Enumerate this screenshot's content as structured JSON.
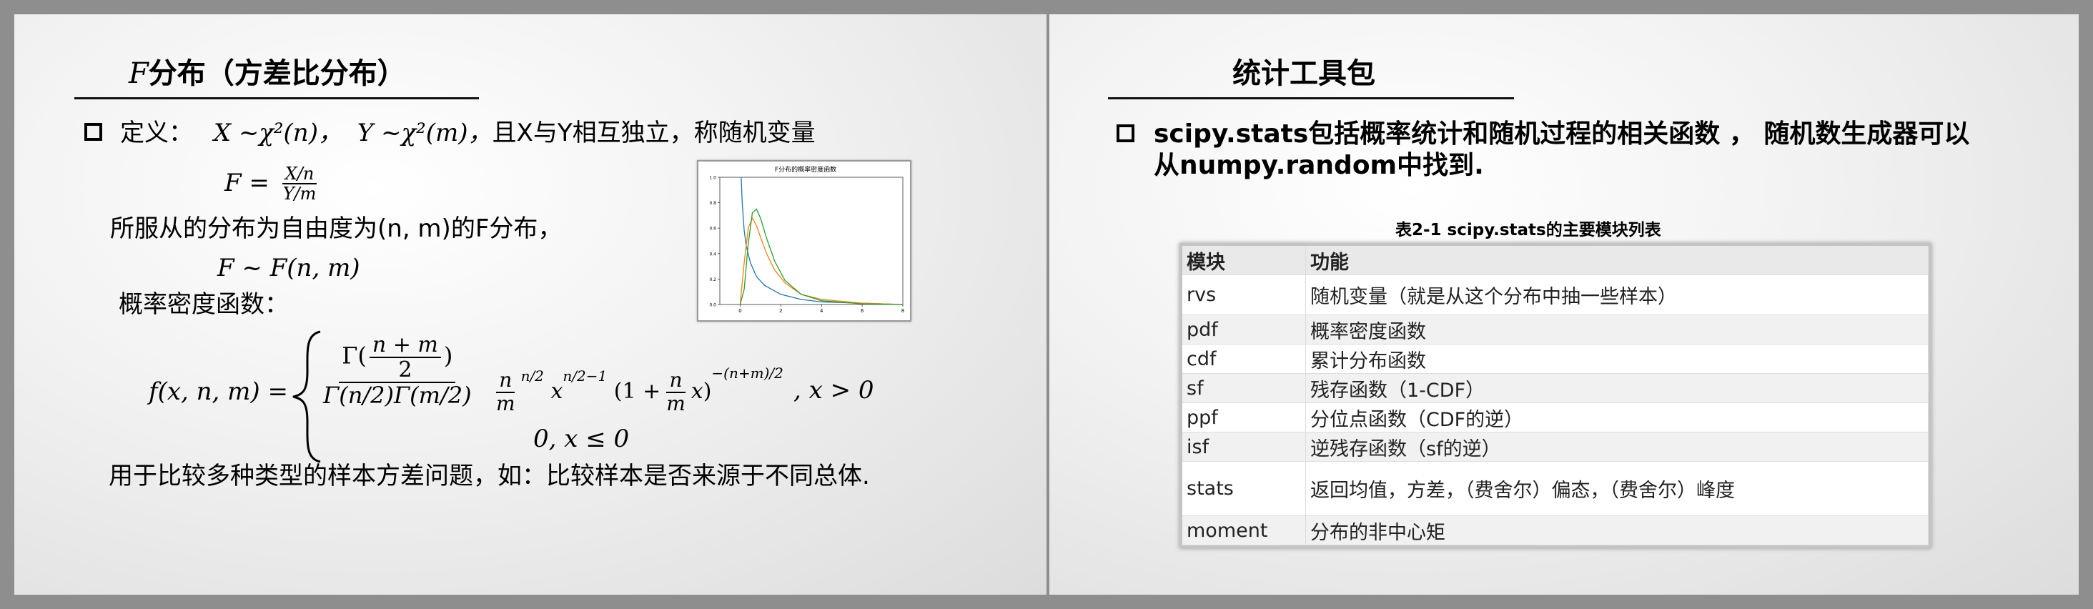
{
  "left_slide": {
    "title_f": "F",
    "title_rest": "分布（方差比分布）",
    "definition": {
      "label": "定义：",
      "x_dist": "X ~χ²(n)，",
      "y_dist": "Y ~χ²(m)，",
      "tail": "且X与Y相互独立，称随机变量"
    },
    "f_def": {
      "lhs": "F =",
      "num": "X/n",
      "den": "Y/m"
    },
    "line_dist": "所服从的分布为自由度为(n, m)的F分布，",
    "f_tilde": "F ~ F(n, m)",
    "pdf_label": "概率密度函数：",
    "formula": {
      "lhs": "f(x, n, m) =",
      "gamma_num": "Γ(",
      "n_plus_m": "n + m",
      "two": "2",
      "close": ")",
      "gamma_den": "Γ(n/2)Γ(m/2)",
      "mid": "(n/m)^(n/2) x^(n/2−1) (1 + (n/m)x)^(−(n+m)/2)",
      "cond1": ", x > 0",
      "case2": "0,   x ≤ 0"
    },
    "usage": "用于比较多种类型的样本方差问题，如：比较样本是否来源于不同总体."
  },
  "chart_data": {
    "type": "line",
    "title": "F分布的概率密度函数",
    "xlim": [
      -1,
      8
    ],
    "ylim": [
      0,
      1.0
    ],
    "x_ticks": [
      "0",
      "2",
      "4",
      "6",
      "8"
    ],
    "y_ticks": [
      "0.0",
      "0.2",
      "0.4",
      "0.6",
      "0.8",
      "1.0"
    ],
    "series": [
      {
        "color": "#1f77b4",
        "x": [
          0.05,
          0.1,
          0.2,
          0.3,
          0.5,
          0.8,
          1.2,
          2,
          3,
          4,
          6,
          8
        ],
        "y": [
          1.0,
          0.8,
          0.58,
          0.46,
          0.33,
          0.22,
          0.15,
          0.08,
          0.04,
          0.02,
          0.01,
          0.0
        ]
      },
      {
        "color": "#ff7f0e",
        "x": [
          0,
          0.2,
          0.4,
          0.6,
          0.8,
          1.0,
          1.3,
          1.7,
          2.2,
          3,
          4,
          6,
          8
        ],
        "y": [
          0,
          0.33,
          0.6,
          0.68,
          0.62,
          0.53,
          0.4,
          0.27,
          0.17,
          0.08,
          0.04,
          0.01,
          0.0
        ]
      },
      {
        "color": "#2ca02c",
        "x": [
          0,
          0.2,
          0.4,
          0.6,
          0.8,
          1.0,
          1.3,
          1.7,
          2.2,
          3,
          4,
          6,
          8
        ],
        "y": [
          0,
          0.12,
          0.48,
          0.72,
          0.75,
          0.68,
          0.52,
          0.34,
          0.19,
          0.08,
          0.03,
          0.005,
          0.0
        ]
      }
    ]
  },
  "right_slide": {
    "title": "统计工具包",
    "bullet_line1": "scipy.stats包括概率统计和随机过程的相关函数 ， 随机数生成器可以",
    "bullet_line2": "从numpy.random中找到.",
    "table_caption": "表2-1 scipy.stats的主要模块列表",
    "table": {
      "headers": [
        "模块",
        "功能"
      ],
      "rows": [
        [
          "rvs",
          "随机变量（就是从这个分布中抽一些样本）"
        ],
        [
          "pdf",
          "概率密度函数"
        ],
        [
          "cdf",
          "累计分布函数"
        ],
        [
          "sf",
          "残存函数（1-CDF）"
        ],
        [
          "ppf",
          "分位点函数（CDF的逆）"
        ],
        [
          "isf",
          "逆残存函数（sf的逆）"
        ],
        [
          "stats",
          "返回均值，方差，（费舍尔）偏态，（费舍尔）峰度"
        ],
        [
          "moment",
          "分布的非中心矩"
        ]
      ]
    }
  }
}
